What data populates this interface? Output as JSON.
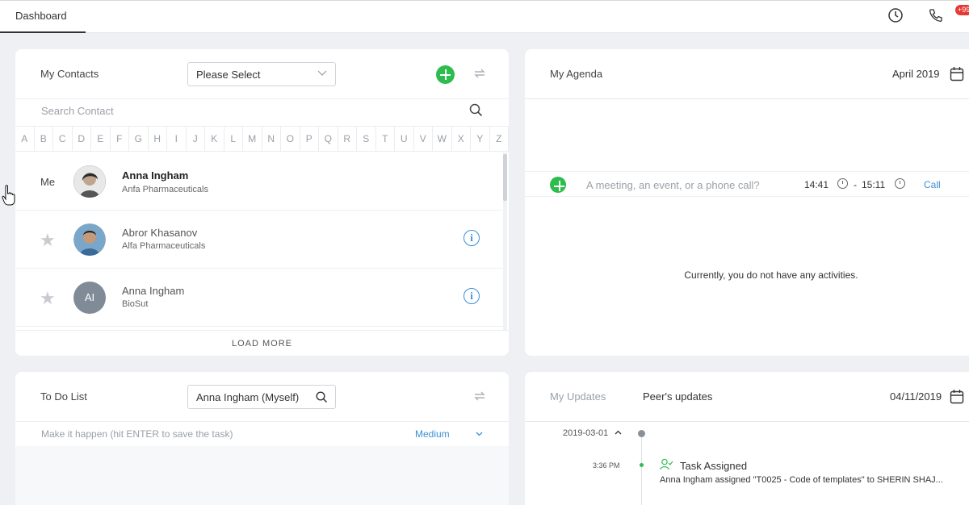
{
  "tabs": {
    "dashboard": "Dashboard"
  },
  "header": {
    "notification_badge": "+99"
  },
  "contacts": {
    "title": "My Contacts",
    "filter_value": "Please Select",
    "search_placeholder": "Search Contact",
    "alphabet": [
      "A",
      "B",
      "C",
      "D",
      "E",
      "F",
      "G",
      "H",
      "I",
      "J",
      "K",
      "L",
      "M",
      "N",
      "O",
      "P",
      "Q",
      "R",
      "S",
      "T",
      "U",
      "V",
      "W",
      "X",
      "Y",
      "Z"
    ],
    "me_label": "Me",
    "items": [
      {
        "name": "Anna Ingham",
        "company": "Anfa Pharmaceuticals"
      },
      {
        "name": "Abror Khasanov",
        "company": "Alfa Pharmaceuticals"
      },
      {
        "name": "Anna Ingham",
        "company": "BioSut",
        "initials": "AI"
      }
    ],
    "load_more": "LOAD MORE"
  },
  "agenda": {
    "title": "My Agenda",
    "month": "April 2019",
    "input_placeholder": "A meeting, an event, or a phone call?",
    "start_time": "14:41",
    "separator": "-",
    "end_time": "15:11",
    "type_link": "Call",
    "empty_message": "Currently, you do not have any activities."
  },
  "todo": {
    "title": "To Do List",
    "assignee": "Anna Ingham (Myself)",
    "task_placeholder": "Make it happen (hit ENTER to save the task)",
    "priority": "Medium"
  },
  "updates": {
    "tab_my": "My Updates",
    "tab_peer": "Peer's updates",
    "date": "04/11/2019",
    "timeline": {
      "group_date": "2019-03-01",
      "entry_time": "3:36 PM",
      "entry_title": "Task Assigned",
      "entry_desc": "Anna Ingham assigned \"T0025 - Code of templates\" to SHERIN SHAJ..."
    }
  },
  "colors": {
    "accent_green": "#2dbd4e",
    "link_blue": "#3d8fd6",
    "badge_red": "#e53935"
  }
}
